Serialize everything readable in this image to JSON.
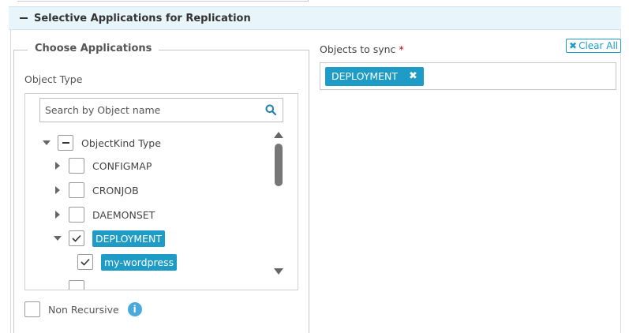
{
  "section": {
    "title": "Selective Applications for Replication"
  },
  "choose_panel": {
    "legend": "Choose Applications",
    "object_type_label": "Object Type",
    "search": {
      "placeholder": "Search by Object name",
      "value": ""
    },
    "tree": {
      "root": {
        "label": "ObjectKind Type",
        "state": "partial",
        "expanded": true
      },
      "items": [
        {
          "label": "CONFIGMAP",
          "checked": false,
          "expanded": false
        },
        {
          "label": "CRONJOB",
          "checked": false,
          "expanded": false
        },
        {
          "label": "DAEMONSET",
          "checked": false,
          "expanded": false
        },
        {
          "label": "DEPLOYMENT",
          "checked": true,
          "expanded": true
        }
      ],
      "child": {
        "label": "my-wordpress",
        "checked": true
      }
    },
    "non_recursive": {
      "label": "Non Recursive",
      "checked": false
    }
  },
  "sync_panel": {
    "label": "Objects to sync",
    "required_marker": "*",
    "clear_all": "Clear All",
    "selected": [
      {
        "label": "DEPLOYMENT"
      }
    ]
  },
  "icons": {
    "collapse": "minus-icon",
    "search": "search-icon",
    "info": "info-icon",
    "remove": "close-icon",
    "clear": "close-icon"
  },
  "colors": {
    "accent": "#1f9cc6",
    "header_bg": "#e8f5fa",
    "info": "#49a9da",
    "required": "#d40000"
  }
}
